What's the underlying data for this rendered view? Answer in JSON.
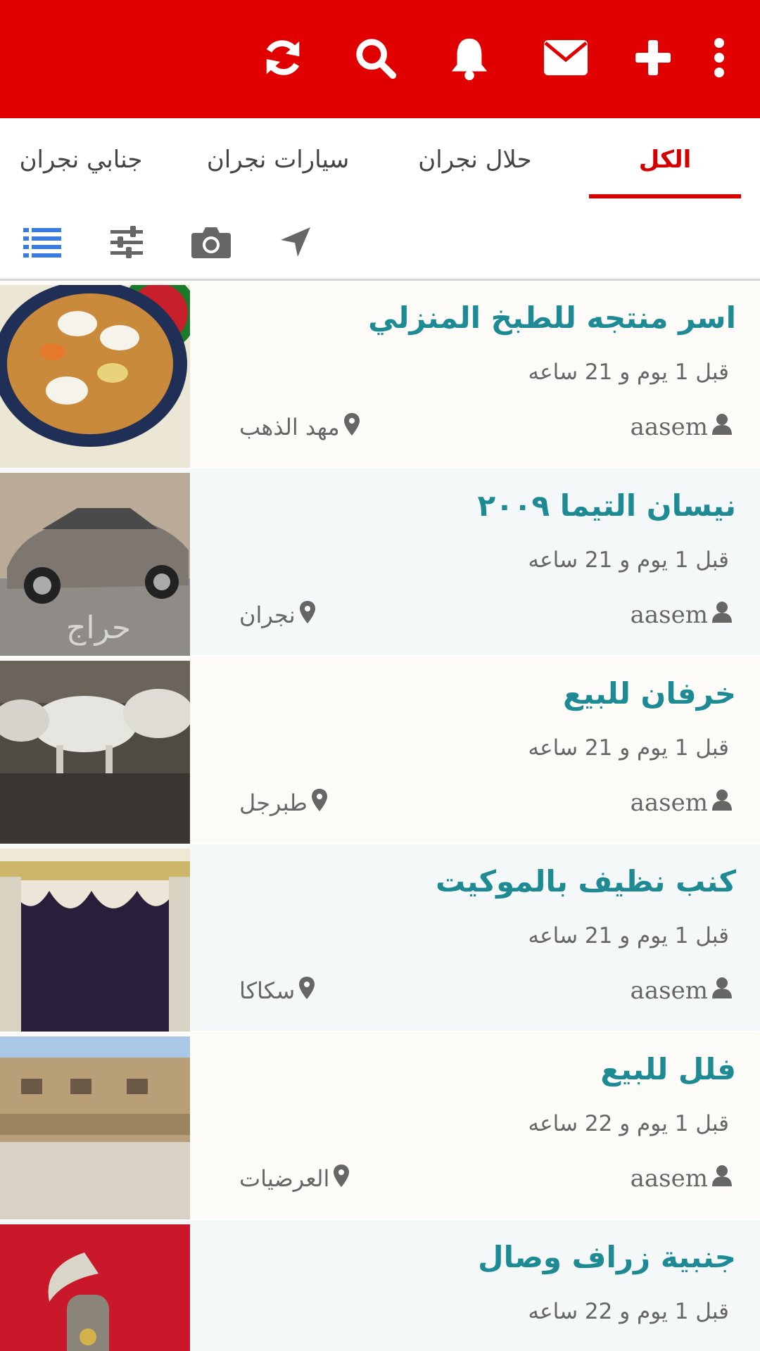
{
  "topbar": {
    "color": "#e00000",
    "icons": [
      "refresh-icon",
      "search-icon",
      "bell-icon",
      "envelope-icon",
      "plus-icon",
      "more-vertical-icon"
    ]
  },
  "tabs": [
    {
      "label": "الكل",
      "active": true
    },
    {
      "label": "حلال نجران",
      "active": false
    },
    {
      "label": "سيارات نجران",
      "active": false
    },
    {
      "label": "جنابي نجران",
      "active": false
    }
  ],
  "toolbar": {
    "icons": [
      "list-view-icon",
      "filter-sliders-icon",
      "camera-icon",
      "location-arrow-icon"
    ]
  },
  "accent_color": "#d40000",
  "title_color": "#1d8a94",
  "listings": [
    {
      "title": "اسر منتجه للطبخ المنزلي",
      "time": "قبل 1 يوم و 21 ساعه",
      "user": "aasem",
      "location": "مهد الذهب"
    },
    {
      "title": "نيسان التيما ٢٠٠٩",
      "time": "قبل 1 يوم و 21 ساعه",
      "user": "aasem",
      "location": "نجران"
    },
    {
      "title": "خرفان للبيع",
      "time": "قبل 1 يوم و 21 ساعه",
      "user": "aasem",
      "location": "طبرجل"
    },
    {
      "title": "كنب نظيف بالموكيت",
      "time": "قبل 1 يوم و 21 ساعه",
      "user": "aasem",
      "location": "سكاكا"
    },
    {
      "title": "فلل للبيع",
      "time": "قبل 1 يوم و 22 ساعه",
      "user": "aasem",
      "location": "العرضيات"
    },
    {
      "title": "جنبية زراف وصال",
      "time": "قبل 1 يوم و 22 ساعه",
      "user": "",
      "location": ""
    }
  ]
}
